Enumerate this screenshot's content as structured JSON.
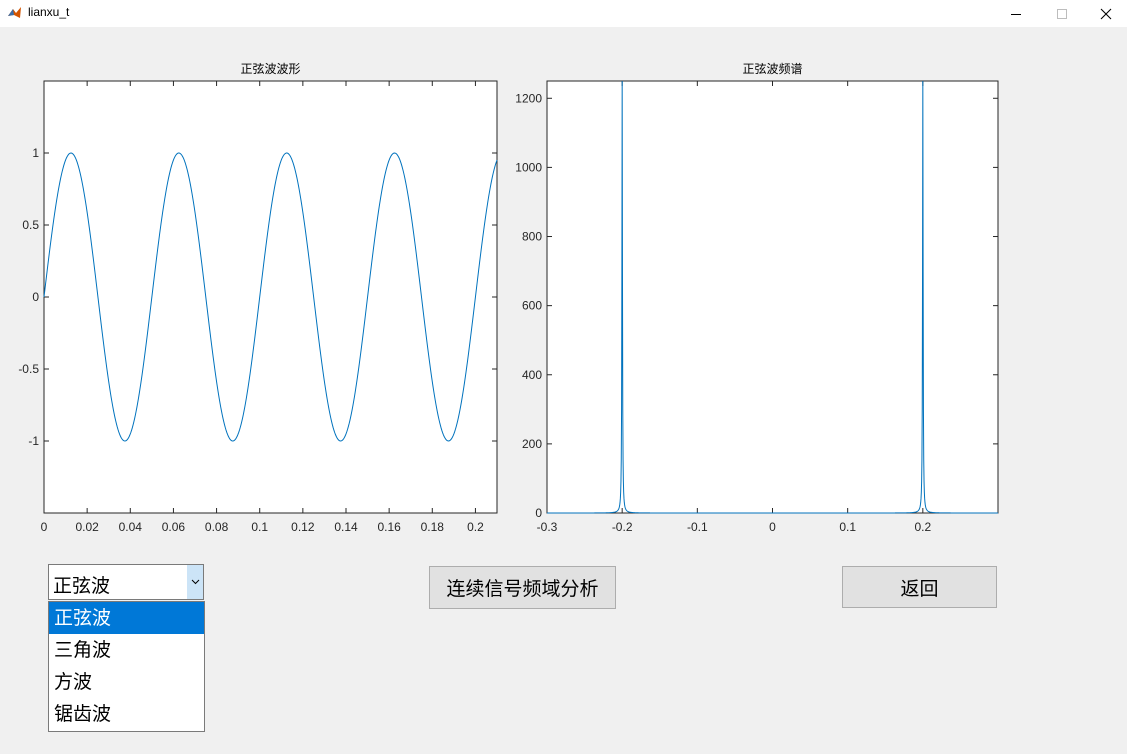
{
  "window": {
    "title": "lianxu_t",
    "icon": "matlab-icon",
    "controls": [
      "minimize-icon",
      "maximize-icon",
      "close-icon"
    ]
  },
  "axes": [
    {
      "title": "正弦波波形",
      "xlim": [
        0,
        0.21
      ],
      "ylim": [
        -1.5,
        1.5
      ],
      "xticks": [
        "0",
        "0.02",
        "0.04",
        "0.06",
        "0.08",
        "0.1",
        "0.12",
        "0.14",
        "0.16",
        "0.18",
        "0.2"
      ],
      "yticks": [
        "1",
        "0.5",
        "0",
        "-0.5",
        "-1"
      ]
    },
    {
      "title": "正弦波频谱",
      "xlim": [
        -0.3,
        0.3
      ],
      "ylim": [
        0,
        1250
      ],
      "xticks": [
        "-0.3",
        "-0.2",
        "-0.1",
        "0",
        "0.1",
        "0.2"
      ],
      "yticks": [
        "1200",
        "1000",
        "800",
        "600",
        "400",
        "200",
        "0"
      ]
    }
  ],
  "chart_data": [
    {
      "type": "line",
      "title": "正弦波波形",
      "xlabel": "",
      "ylabel": "",
      "xlim": [
        0,
        0.21
      ],
      "ylim": [
        -1.5,
        1.5
      ],
      "series": [
        {
          "function": "sin",
          "amplitude": 1,
          "frequency": 20,
          "x_range": [
            0,
            0.21
          ],
          "color": "#0072bd"
        }
      ]
    },
    {
      "type": "line",
      "title": "正弦波频谱",
      "xlabel": "",
      "ylabel": "",
      "xlim": [
        -0.3,
        0.3
      ],
      "ylim": [
        0,
        1250
      ],
      "series": [
        {
          "peaks": [
            {
              "x": -0.2,
              "y": 1250
            },
            {
              "x": 0.2,
              "y": 1250
            }
          ],
          "baseline": 0,
          "color": "#0072bd"
        }
      ]
    }
  ],
  "controls": {
    "signal_select": {
      "value": "正弦波",
      "options": [
        "正弦波",
        "三角波",
        "方波",
        "锯齿波"
      ],
      "selected_index": 0
    },
    "analyze_button": "连续信号频域分析",
    "back_button": "返回"
  },
  "colors": {
    "line": "#0072bd",
    "selection": "#0078d7",
    "dropdown_arrow_bg": "#cce4f7"
  }
}
